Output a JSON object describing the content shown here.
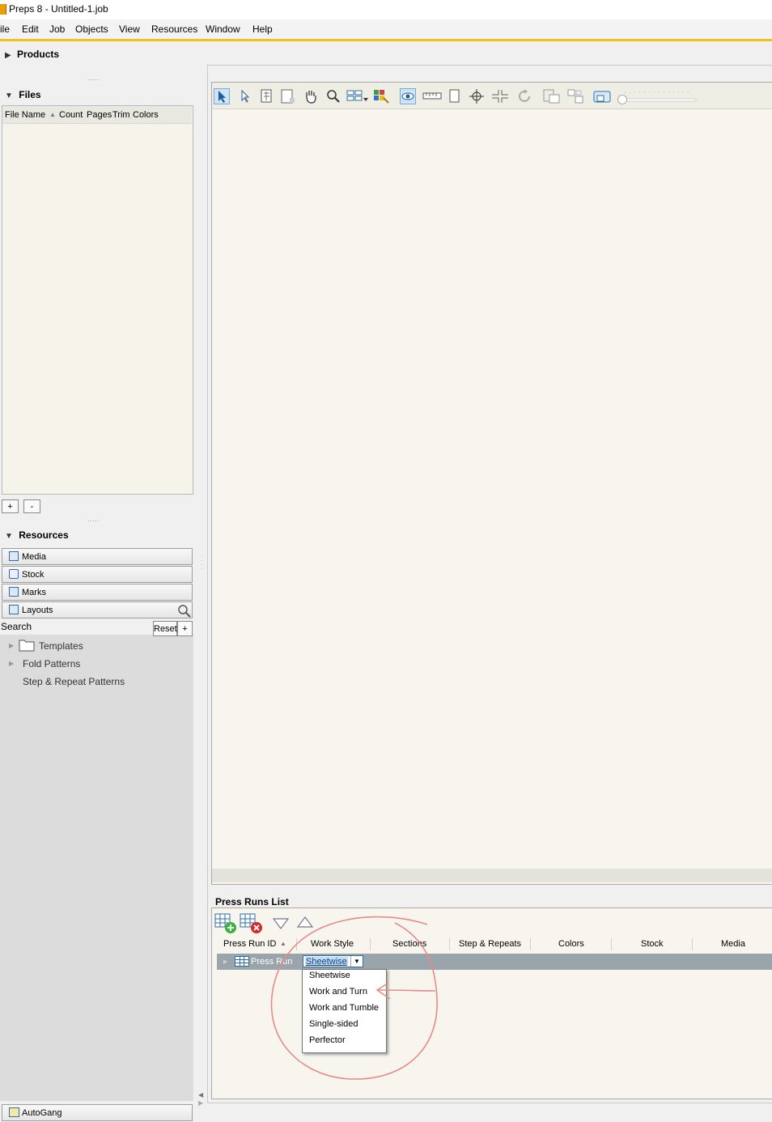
{
  "window": {
    "title": "Preps 8 - Untitled-1.job"
  },
  "menu": [
    "ile",
    "Edit",
    "Job",
    "Objects",
    "View",
    "Resources",
    "Window",
    "Help"
  ],
  "colors": {
    "accent": "#f5c21b",
    "selection_row": "#99a4ab",
    "annotation": "#e88a8a",
    "panel_bg": "#f7f5ee"
  },
  "left_panel": {
    "products_label": "Products",
    "files_label": "Files",
    "files_columns": [
      "File Name",
      "Count",
      "Pages",
      "Trim",
      "Colors"
    ],
    "add_label": "+",
    "remove_label": "-",
    "resources_label": "Resources",
    "resource_tabs": [
      "Media",
      "Stock",
      "Marks",
      "Layouts"
    ],
    "search_label": "Search",
    "reset_label": "Reset",
    "plus_label": "+",
    "tree": [
      "Templates",
      "Fold Patterns",
      "Step & Repeat Patterns"
    ],
    "autogang_label": "AutoGang"
  },
  "toolbar": {
    "icons": [
      "select-arrow-icon",
      "direct-select-icon",
      "page-grid-icon",
      "page-icon",
      "hand-icon",
      "zoom-icon",
      "layout-dropdown-icon",
      "color-icon",
      "eye-icon",
      "ruler-icon",
      "page-blank-icon",
      "crosshair-icon",
      "split-icon",
      "rotate-icon",
      "frame-icon",
      "frame-group-icon",
      "display-icon",
      "zoom-slider"
    ]
  },
  "press_runs": {
    "title": "Press Runs List",
    "columns": [
      "Press Run ID",
      "Work Style",
      "Sections",
      "Step & Repeats",
      "Colors",
      "Stock",
      "Media"
    ],
    "row": {
      "id": "Press Run",
      "work_style": "Sheetwise"
    },
    "dropdown_options": [
      "Sheetwise",
      "Work and Turn",
      "Work and Tumble",
      "Single-sided",
      "Perfector"
    ]
  }
}
